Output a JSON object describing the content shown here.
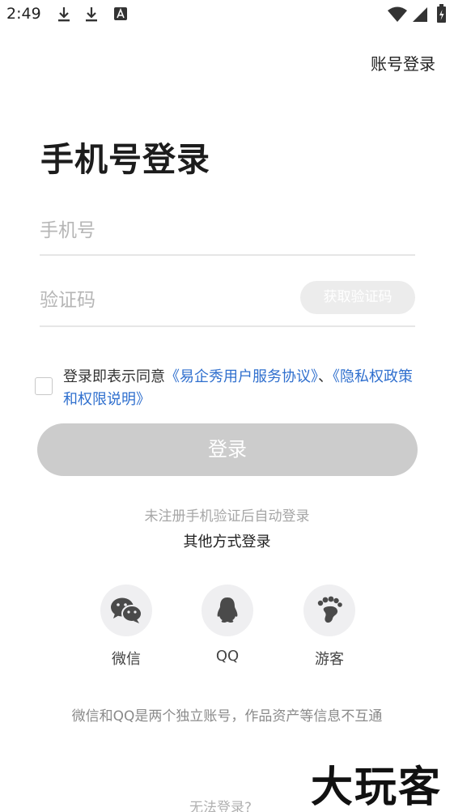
{
  "status_bar": {
    "time": "2:49"
  },
  "header": {
    "account_login": "账号登录"
  },
  "title": "手机号登录",
  "form": {
    "phone_placeholder": "手机号",
    "code_placeholder": "验证码",
    "get_code": "获取验证码"
  },
  "agreement": {
    "prefix": "登录即表示同意",
    "service_link": "《易企秀用户服务协议》",
    "separator": "、",
    "privacy_link": "《隐私权政策和权限说明》"
  },
  "login_button": "登录",
  "auto_register_hint": "未注册手机验证后自动登录",
  "other_methods": "其他方式登录",
  "social": [
    {
      "label": "微信",
      "icon": "wechat-icon"
    },
    {
      "label": "QQ",
      "icon": "qq-icon"
    },
    {
      "label": "游客",
      "icon": "footprint-icon"
    }
  ],
  "notice": "微信和QQ是两个独立账号，作品资产等信息不互通",
  "cant_login": "无法登录?",
  "watermark": "大玩客",
  "colors": {
    "link": "#2f6fce",
    "disabled_button": "#cccccc",
    "icon_bg": "#efeff1"
  }
}
